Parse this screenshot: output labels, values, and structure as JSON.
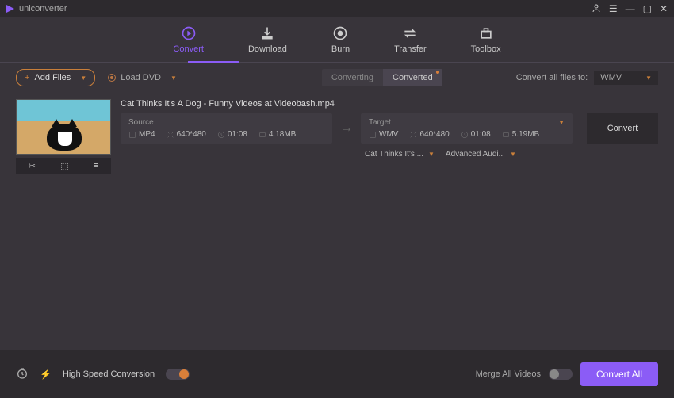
{
  "app": {
    "name": "uniconverter"
  },
  "tabs": {
    "convert": "Convert",
    "download": "Download",
    "burn": "Burn",
    "transfer": "Transfer",
    "toolbox": "Toolbox"
  },
  "toolbar": {
    "add_files": "Add Files",
    "load_dvd": "Load DVD",
    "seg_converting": "Converting",
    "seg_converted": "Converted",
    "convert_all_to": "Convert all files to:",
    "format_selected": "WMV"
  },
  "file": {
    "name": "Cat Thinks It's A Dog - Funny Videos at Videobash.mp4",
    "source": {
      "label": "Source",
      "format": "MP4",
      "resolution": "640*480",
      "duration": "01:08",
      "size": "4.18MB"
    },
    "target": {
      "label": "Target",
      "format": "WMV",
      "resolution": "640*480",
      "duration": "01:08",
      "size": "5.19MB"
    },
    "convert_btn": "Convert",
    "subtitle_select": "Cat Thinks It's ...",
    "audio_select": "Advanced Audi..."
  },
  "footer": {
    "hsc": "High Speed Conversion",
    "merge": "Merge All Videos",
    "convert_all": "Convert All"
  }
}
